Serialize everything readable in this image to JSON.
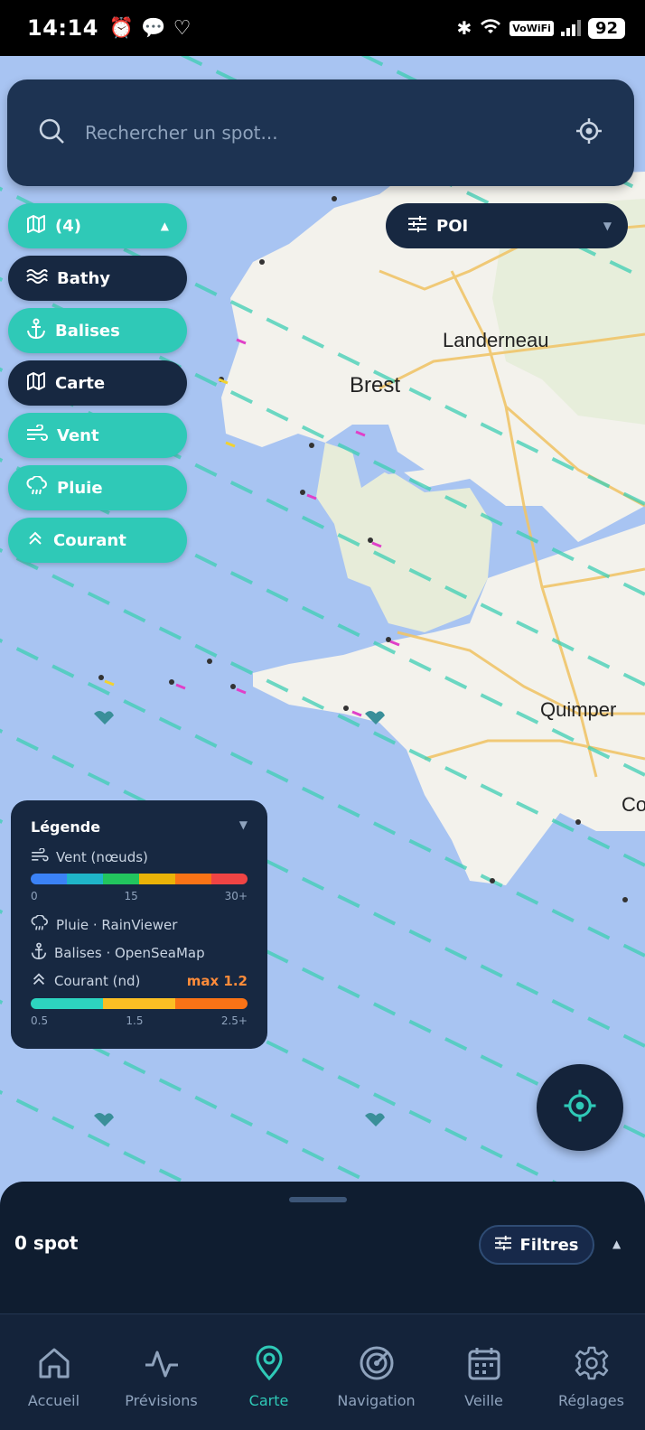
{
  "status": {
    "time": "14:14",
    "battery": "92",
    "vowifi": "VoWiFi"
  },
  "search": {
    "placeholder": "Rechercher un spot..."
  },
  "layers": {
    "toggle_label": "(4)",
    "items": [
      {
        "label": "Bathy",
        "active": false,
        "icon": "waves-icon"
      },
      {
        "label": "Balises",
        "active": true,
        "icon": "anchor-icon"
      },
      {
        "label": "Carte",
        "active": false,
        "icon": "map-icon"
      },
      {
        "label": "Vent",
        "active": true,
        "icon": "wind-icon"
      },
      {
        "label": "Pluie",
        "active": true,
        "icon": "rain-icon"
      },
      {
        "label": "Courant",
        "active": true,
        "icon": "chevrons-up-icon"
      }
    ]
  },
  "poi": {
    "label": "POI"
  },
  "map": {
    "cities": [
      "Landerneau",
      "Brest",
      "Quimper",
      "Co"
    ]
  },
  "legend": {
    "title": "Légende",
    "wind": {
      "label": "Vent (nœuds)",
      "colors": [
        "#3b82f6",
        "#1fb5c9",
        "#22c55e",
        "#eab308",
        "#f97316",
        "#ef4444"
      ],
      "ticks": [
        "0",
        "15",
        "30+"
      ]
    },
    "rain": {
      "label": "Pluie · RainViewer"
    },
    "buoys": {
      "label": "Balises · OpenSeaMap"
    },
    "current": {
      "label": "Courant (nd)",
      "max": "max 1.2",
      "colors": [
        "#2dd4bf",
        "#fbbf24",
        "#f97316"
      ],
      "ticks": [
        "0.5",
        "1.5",
        "2.5+"
      ]
    }
  },
  "sheet": {
    "spots": "0 spot",
    "filters": "Filtres"
  },
  "nav": [
    {
      "label": "Accueil",
      "active": false
    },
    {
      "label": "Prévisions",
      "active": false
    },
    {
      "label": "Carte",
      "active": true
    },
    {
      "label": "Navigation",
      "active": false
    },
    {
      "label": "Veille",
      "active": false
    },
    {
      "label": "Réglages",
      "active": false
    }
  ],
  "colors": {
    "accent": "#2fc9b7",
    "panel": "#172841",
    "sea": "#a8c4f2",
    "land": "#f3f2ec"
  }
}
